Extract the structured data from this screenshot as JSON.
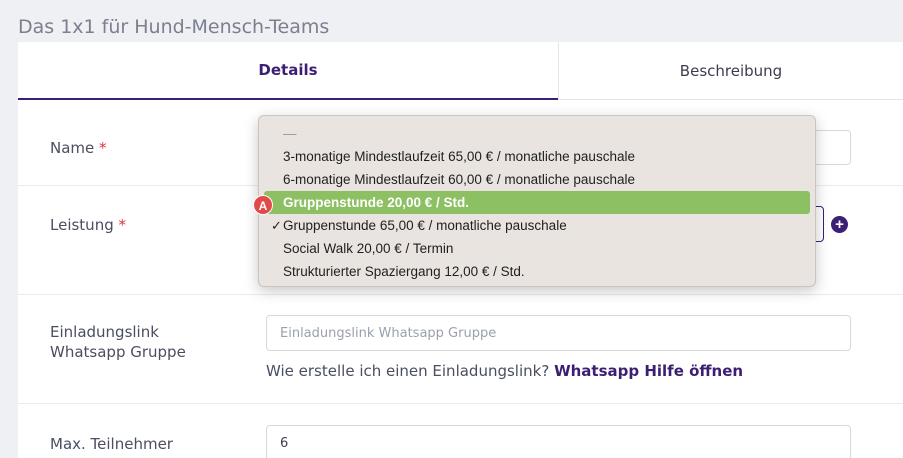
{
  "page": {
    "title": "Das 1x1 für Hund-Mensch-Teams"
  },
  "tabs": [
    {
      "label": "Details"
    },
    {
      "label": "Beschreibung"
    }
  ],
  "form": {
    "name": {
      "label": "Name",
      "required_mark": "*",
      "value": ""
    },
    "leistung": {
      "label": "Leistung",
      "required_mark": "*",
      "add_icon": "plus-circle-icon"
    },
    "whatsapp": {
      "label_line1": "Einladungslink",
      "label_line2": "Whatsapp Gruppe",
      "placeholder": "Einladungslink Whatsapp Gruppe",
      "help_text": "Wie erstelle ich einen Einladungslink?",
      "help_link": "Whatsapp Hilfe öffnen"
    },
    "max_teilnehmer": {
      "label": "Max. Teilnehmer",
      "value": "6"
    }
  },
  "dropdown": {
    "options": [
      {
        "label": "—"
      },
      {
        "label": "3-monatige Mindestlaufzeit 65,00 € / monatliche pauschale"
      },
      {
        "label": "6-monatige Mindestlaufzeit 60,00 € / monatliche pauschale"
      },
      {
        "label": "Gruppenstunde 20,00 € / Std."
      },
      {
        "label": "Gruppenstunde 65,00 € / monatliche pauschale",
        "check": "✓"
      },
      {
        "label": "Social Walk 20,00 € / Termin"
      },
      {
        "label": "Strukturierter Spaziergang 12,00 € / Std."
      }
    ],
    "highlighted_index": 3,
    "checked_index": 4,
    "highlight_color": "#8cc063"
  },
  "annotation": {
    "badge": "A"
  }
}
